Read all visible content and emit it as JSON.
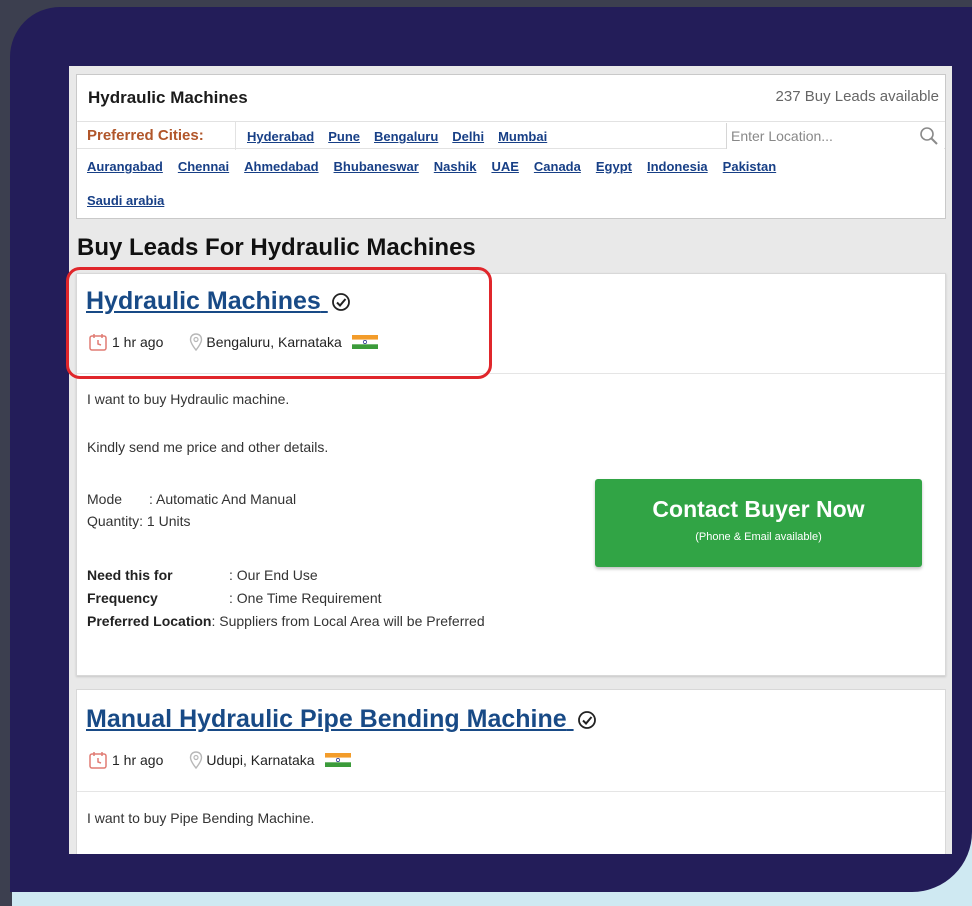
{
  "filter": {
    "title": "Hydraulic Machines",
    "lead_count": "237 Buy Leads available",
    "preferred_label": "Preferred Cities:",
    "preferred_cities": [
      "Hyderabad",
      "Pune",
      "Bengaluru",
      "Delhi",
      "Mumbai"
    ],
    "location_placeholder": "Enter Location...",
    "more_cities_row1": [
      "Aurangabad",
      "Chennai",
      "Ahmedabad",
      "Bhubaneswar",
      "Nashik",
      "UAE",
      "Canada",
      "Egypt",
      "Indonesia",
      "Pakistan"
    ],
    "more_cities_row2": [
      "Saudi arabia"
    ]
  },
  "section_title": "Buy Leads For Hydraulic Machines",
  "leads": [
    {
      "title": "Hydraulic Machines",
      "time": "1 hr ago",
      "location": "Bengaluru, Karnataka",
      "desc1": "I want to buy Hydraulic machine.",
      "desc2": "Kindly send me price and other details.",
      "mode_label": "Mode",
      "mode_value": ": Automatic And Manual",
      "qty_label": "Quantity",
      "qty_value": ": 1 Units",
      "need_label": "Need this for",
      "need_value": ": Our End Use",
      "freq_label": "Frequency",
      "freq_value": ": One Time Requirement",
      "pref_loc_label": "Preferred Location",
      "pref_loc_value": ": Suppliers from Local Area will be Preferred",
      "cta_main": "Contact Buyer Now",
      "cta_sub": "(Phone & Email available)"
    },
    {
      "title": "Manual Hydraulic Pipe Bending Machine",
      "time": "1 hr ago",
      "location": "Udupi, Karnataka",
      "desc1": "I want to buy Pipe Bending Machine."
    }
  ],
  "colors": {
    "background": "#231d59",
    "highlight": "#e0262b",
    "cta": "#31a445",
    "link": "#184a86"
  }
}
